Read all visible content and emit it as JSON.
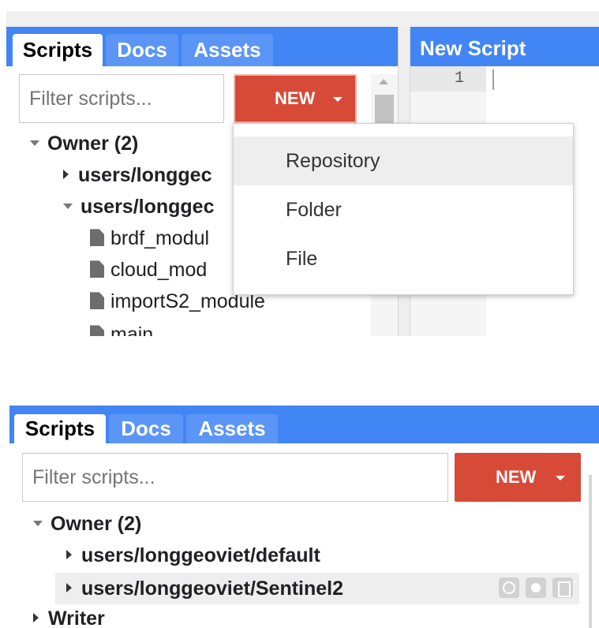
{
  "top_panel": {
    "tabs": [
      {
        "label": "Scripts",
        "active": true
      },
      {
        "label": "Docs",
        "active": false
      },
      {
        "label": "Assets",
        "active": false
      }
    ],
    "filter_placeholder": "Filter scripts...",
    "new_button": "NEW",
    "editor": {
      "title": "New Script",
      "line_number": "1"
    },
    "tree": {
      "owner": "Owner",
      "owner_count": "(2)",
      "repo_collapsed": "users/longgec",
      "repo_expanded": "users/longgec",
      "files": [
        "brdf_modul",
        "cloud_mod",
        "importS2_module",
        "main"
      ]
    },
    "dropdown": {
      "items": [
        {
          "label": "Repository",
          "highlighted": true
        },
        {
          "label": "Folder",
          "highlighted": false
        },
        {
          "label": "File",
          "highlighted": false
        }
      ]
    }
  },
  "bottom_panel": {
    "tabs": [
      {
        "label": "Scripts",
        "active": true
      },
      {
        "label": "Docs",
        "active": false
      },
      {
        "label": "Assets",
        "active": false
      }
    ],
    "filter_placeholder": "Filter scripts...",
    "new_button": "NEW",
    "tree": {
      "owner": "Owner",
      "owner_count": "(2)",
      "repos": [
        "users/longgeoviet/default",
        "users/longgeoviet/Sentinel2"
      ],
      "writer": "Writer"
    }
  },
  "colors": {
    "tab_bar": "#4285f4",
    "new_button": "#d84a38",
    "dropdown_highlight": "#eeeeee"
  }
}
